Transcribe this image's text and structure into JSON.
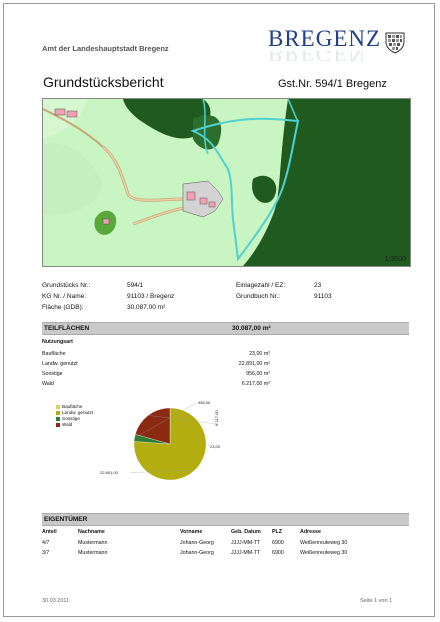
{
  "header": {
    "organization": "Amt der Landeshauptstadt Bregenz",
    "brand": "BREGENZ",
    "crest_icon": "city-coat-of-arms"
  },
  "report": {
    "title": "Grundstücksbericht",
    "parcel": "Gst.Nr. 594/1  Bregenz"
  },
  "map": {
    "scale": "1:3500"
  },
  "info": {
    "rows": [
      {
        "label": "Grundstücks Nr.:",
        "value": "594/1",
        "label2": "Einlagezahl / EZ:",
        "value2": "23"
      },
      {
        "label": "KG Nr. / Name:",
        "value": "91103 / Bregenz",
        "label2": "Grundbuch Nr.:",
        "value2": "91103"
      },
      {
        "label": "Fläche (GDB):",
        "value": "30.087,00 m²",
        "label2": "",
        "value2": ""
      }
    ]
  },
  "teilflaechen": {
    "heading": "TEILFLÄCHEN",
    "total": "30.087,00 m²",
    "subheading": "Nutzungsart",
    "rows": [
      {
        "name": "Baufläche",
        "value": "23,00 m²"
      },
      {
        "name": "Landw. genutzt",
        "value": "22.891,00 m²"
      },
      {
        "name": "Sonstige",
        "value": "956,00 m²"
      },
      {
        "name": "Wald",
        "value": "6.217,00 m²"
      }
    ]
  },
  "chart_data": {
    "type": "pie",
    "categories": [
      "Baufläche",
      "Landw. genutzt",
      "Sonstige",
      "Wald"
    ],
    "values": [
      23.0,
      22891.0,
      956.0,
      6217.0
    ],
    "data_labels": [
      "23,00",
      "22.891,00",
      "956,00",
      "6.217,00"
    ],
    "colors": [
      "#d9d26a",
      "#b3ad10",
      "#2e7d32",
      "#8b2a10"
    ],
    "legend": "top-left"
  },
  "eigentuemer": {
    "heading": "EIGENTÜMER",
    "columns": [
      "Anteil",
      "Nachname",
      "Vorname",
      "Geb. Datum",
      "PLZ",
      "Adresse"
    ],
    "rows": [
      [
        "4/7",
        "Mustermann",
        "Johann-Georg",
        "JJJJ-MM-TT",
        "6900",
        "Weißenreuteweg 30"
      ],
      [
        "3/7",
        "Mustermann",
        "Johann-Georg",
        "JJJJ-MM-TT",
        "6900",
        "Weißenreuteweg 30"
      ]
    ]
  },
  "footer": {
    "date": "30.03.2011",
    "page": "Seite 1 von 1"
  }
}
